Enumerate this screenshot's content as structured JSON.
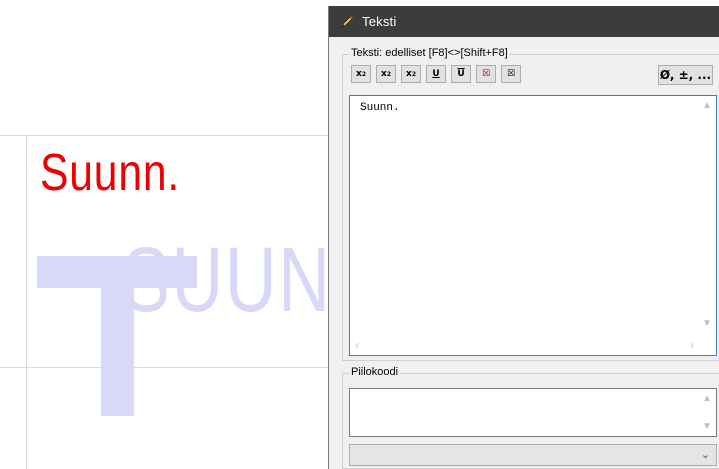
{
  "canvas": {
    "red_text": "Suunn.",
    "ghost_text": "SUUNN"
  },
  "dialog": {
    "title": "Teksti",
    "text_group": {
      "label": "Teksti:  edelliset [F8]<>[Shift+F8]",
      "toolbar": [
        {
          "name": "superscript-button",
          "glyph": "x",
          "mark": "2",
          "mark_type": "sup"
        },
        {
          "name": "subscript-button",
          "glyph": "x",
          "mark": "2",
          "mark_type": "sub"
        },
        {
          "name": "sup-sub-button",
          "glyph": "x",
          "mark": "2",
          "mark_type": "supsub"
        },
        {
          "name": "underline-button",
          "glyph": "U",
          "mark": "",
          "mark_type": "underline"
        },
        {
          "name": "overline-button",
          "glyph": "U",
          "mark": "",
          "mark_type": "overline"
        },
        {
          "name": "boxed-x-button",
          "glyph": "☒",
          "mark": "",
          "mark_type": "box"
        },
        {
          "name": "clear-x-button",
          "glyph": "☒",
          "mark": "",
          "mark_type": "box-plain"
        }
      ],
      "symbols_button": "Ø, ±, ...",
      "content": "Suunn."
    },
    "code_group": {
      "label": "Piilokoodi",
      "value": "",
      "select_value": ""
    }
  }
}
